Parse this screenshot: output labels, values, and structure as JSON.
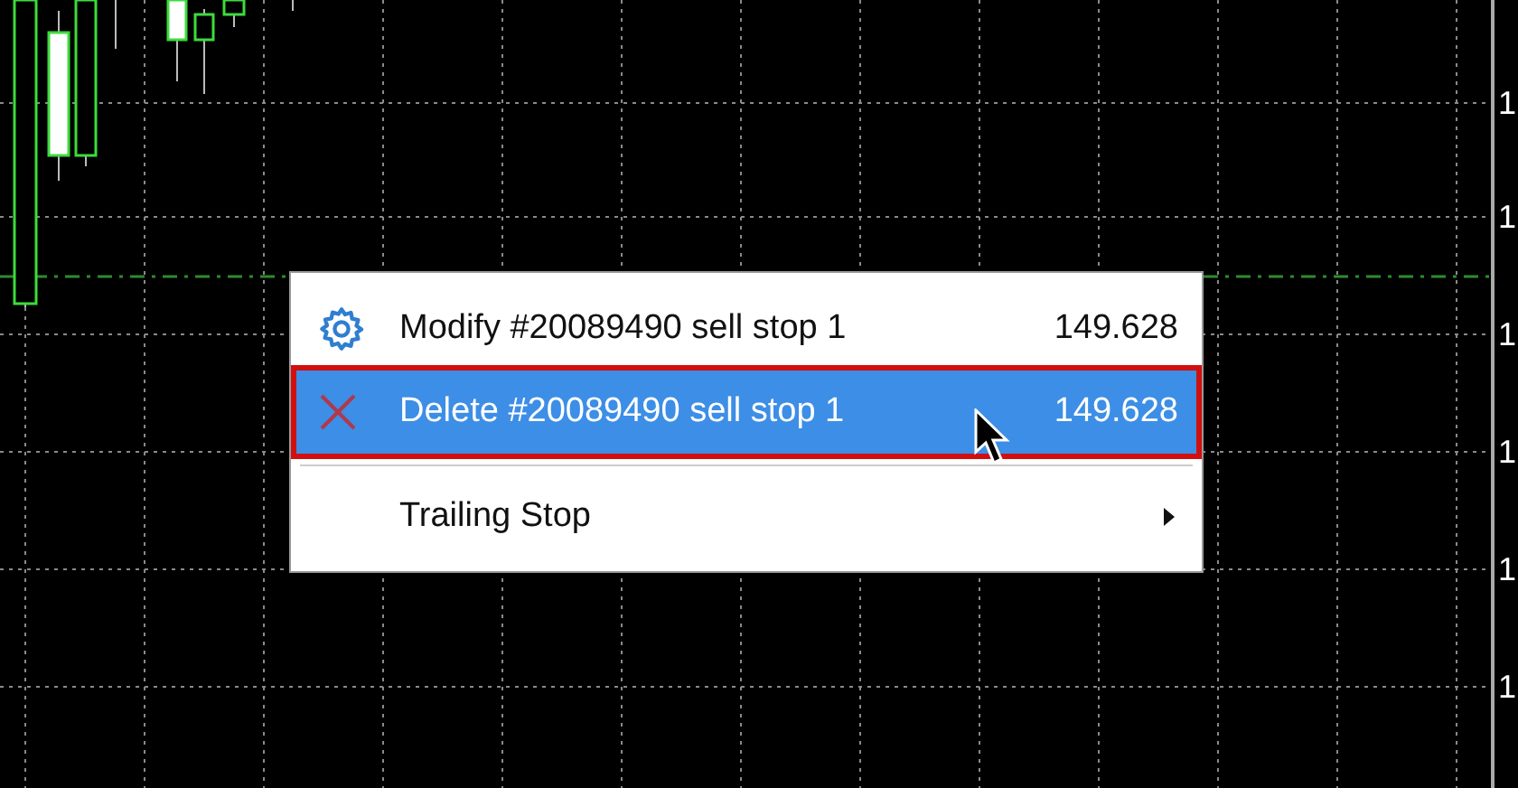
{
  "price_axis": {
    "labels": [
      "1",
      "1",
      "1",
      "1",
      "1",
      "1"
    ]
  },
  "context_menu": {
    "items": [
      {
        "kind": "action",
        "label": "Modify #20089490 sell stop 1",
        "price": "149.628",
        "selected": false,
        "outlined": false
      },
      {
        "kind": "action",
        "label": "Delete #20089490 sell stop 1",
        "price": "149.628",
        "selected": true,
        "outlined": true
      },
      {
        "kind": "separator"
      },
      {
        "kind": "submenu",
        "label": "Trailing Stop"
      }
    ]
  }
}
